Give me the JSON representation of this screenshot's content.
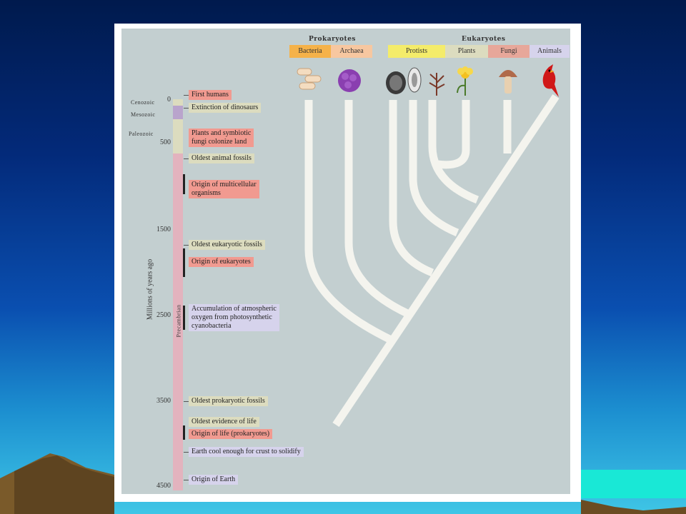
{
  "groups": {
    "prokaryotes": "Prokaryotes",
    "eukaryotes": "Eukaryotes",
    "bacteria": "Bacteria",
    "archaea": "Archaea",
    "protists": "Protists",
    "plants": "Plants",
    "fungi": "Fungi",
    "animals": "Animals"
  },
  "eras": {
    "cenozoic": "Cenozoic",
    "mesozoic": "Mesozoic",
    "paleozoic": "Paleozoic",
    "precambrian": "Precambrian"
  },
  "axis": {
    "label": "Millions of years ago",
    "ticks": [
      "0",
      "500",
      "1500",
      "2500",
      "3500",
      "4500"
    ]
  },
  "events": [
    "First humans",
    "Extinction of dinosaurs",
    "Plants and symbiotic",
    "fungi colonize land",
    "Oldest animal fossils",
    "Origin of multicellular",
    "organisms",
    "Oldest eukaryotic fossils",
    "Origin of eukaryotes",
    "Accumulation of atmospheric",
    "oxygen from photosynthetic",
    "cyanobacteria",
    "Oldest prokaryotic fossils",
    "Oldest evidence of life",
    "Origin of life (prokaryotes)",
    "Earth cool enough for crust to solidify",
    "Origin of Earth"
  ],
  "colors": {
    "background_top": "#001a4d",
    "background_bottom": "#3fc6e6",
    "panel": "#c3cfd0",
    "bacteria": "#f5b24a",
    "archaea": "#f7c7a0",
    "protists": "#f4ec6a",
    "plants": "#dcdcbf",
    "fungi": "#e7a79a",
    "animals": "#d6d3ec",
    "tree": "#f4f4ee"
  }
}
